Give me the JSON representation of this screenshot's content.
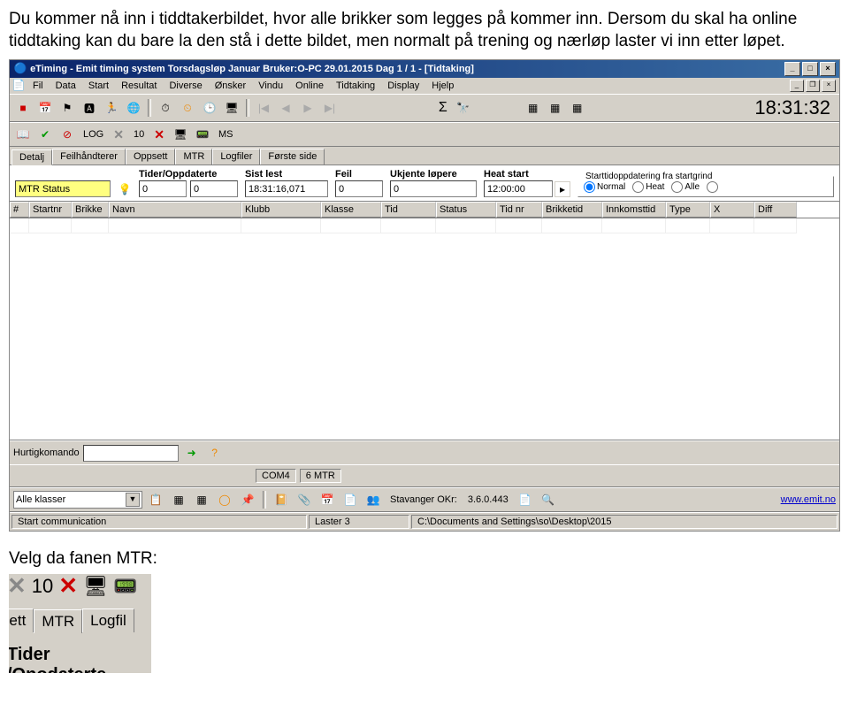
{
  "instructions": {
    "p1": "Du kommer nå inn i tiddtakerbildet, hvor alle brikker som legges på kommer inn. Dersom du skal ha online tiddtaking kan du bare la den stå i dette bildet, men normalt på trening og nærløp laster vi inn etter løpet."
  },
  "window": {
    "title": "eTiming - Emit timing system  Torsdagsløp Januar   Bruker:O-PC   29.01.2015  Dag 1 / 1 - [Tidtaking]",
    "min": "_",
    "max": "□",
    "close": "×"
  },
  "menubar": {
    "items": [
      "Fil",
      "Data",
      "Start",
      "Resultat",
      "Diverse",
      "Ønsker",
      "Vindu",
      "Online",
      "Tidtaking",
      "Display",
      "Hjelp"
    ]
  },
  "toolbar1": {
    "sigma": "Σ",
    "binoc": "👀",
    "clock": "18:31:32"
  },
  "toolbar2": {
    "check": "✔",
    "no": "⊘",
    "log": "LOG",
    "x1": "✕",
    "ten": "10",
    "x2": "✕",
    "ms": "MS"
  },
  "tabs": {
    "items": [
      "Detalj",
      "Feilhåndterer",
      "Oppsett",
      "MTR",
      "Logfiler",
      "Første side"
    ]
  },
  "filter": {
    "mtr_label_value": "MTR Status",
    "tider_label": "Tider/Oppdaterte",
    "tider1": "0",
    "tider2": "0",
    "sistlest_label": "Sist lest",
    "sistlest": "18:31:16,071",
    "feil_label": "Feil",
    "feil": "0",
    "ukjente_label": "Ukjente løpere",
    "ukjente": "0",
    "heat_label": "Heat start",
    "heat": "12:00:00",
    "radio_legend": "Starttidoppdatering fra startgrind",
    "radios": [
      "Normal",
      "Heat",
      "Alle",
      ""
    ]
  },
  "grid": {
    "headers": [
      "#",
      "Startnr",
      "Brikke",
      "Navn",
      "Klubb",
      "Klasse",
      "Tid",
      "Status",
      "Tid nr",
      "Brikketid",
      "Innkomsttid",
      "Type",
      "X",
      "Diff"
    ]
  },
  "bottom": {
    "hurtig_label": "Hurtigkomando",
    "com_label": "COM4",
    "mtr6": "6  MTR",
    "alleklasser": "Alle klasser",
    "stav": "Stavanger OKr:",
    "ver": "3.6.0.443",
    "emit": "www.emit.no",
    "start_comm": "Start communication",
    "laster": "Laster 3",
    "path": "C:\\Documents and Settings\\so\\Desktop\\2015"
  },
  "posttext": "Velg da fanen MTR:",
  "crop": {
    "ten": "10",
    "tabs": [
      "ppsett",
      "MTR",
      "Logfil"
    ],
    "bottom": "Tider /Onodaterte"
  }
}
